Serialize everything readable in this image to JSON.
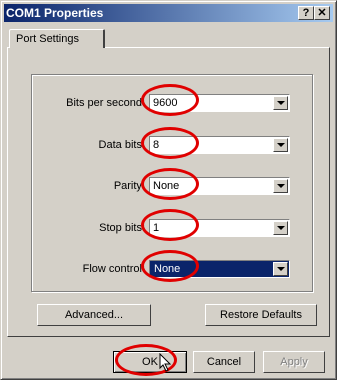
{
  "window": {
    "title": "COM1 Properties",
    "help_glyph": "?",
    "close_glyph": "✕"
  },
  "tabs": [
    {
      "label": "Port Settings"
    }
  ],
  "settings": [
    {
      "label": "Bits per second:",
      "value": "9600"
    },
    {
      "label": "Data bits:",
      "value": "8"
    },
    {
      "label": "Parity:",
      "value": "None"
    },
    {
      "label": "Stop bits:",
      "value": "1"
    },
    {
      "label": "Flow control:",
      "value": "None"
    }
  ],
  "buttons": {
    "advanced": "Advanced...",
    "restore": "Restore Defaults",
    "ok": "OK",
    "cancel": "Cancel",
    "apply": "Apply"
  },
  "colors": {
    "title_start": "#0a246a",
    "title_end": "#a6caf0",
    "annotation": "#e00000",
    "selection": "#0a246a"
  }
}
